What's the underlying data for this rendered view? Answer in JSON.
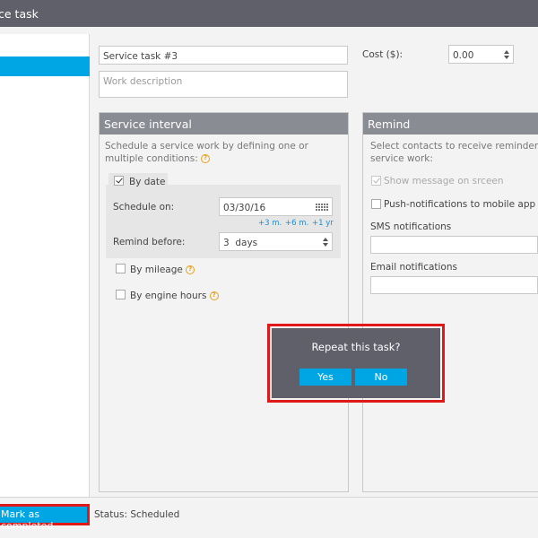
{
  "window": {
    "title": "ce task"
  },
  "task": {
    "name_value": "Service task #3",
    "description_placeholder": "Work description",
    "cost_label": "Cost ($):",
    "cost_value": "0.00"
  },
  "service_interval": {
    "title": "Service interval",
    "description": "Schedule a service work by defining one or multiple conditions:",
    "by_date": {
      "label": "By date",
      "checked": true,
      "schedule_label": "Schedule on:",
      "schedule_value": "03/30/16",
      "shortcuts": [
        "+3 m.",
        "+6 m.",
        "+1 yr"
      ],
      "remind_label": "Remind before:",
      "remind_value": "3  days"
    },
    "by_mileage": {
      "label": "By mileage",
      "checked": false
    },
    "by_engine_hours": {
      "label": "By engine hours",
      "checked": false
    }
  },
  "remind": {
    "title": "Remind",
    "description_line1": "Select contacts to receive reminders tha",
    "description_line2": "service work:",
    "show_message": {
      "label": "Show message on srceen",
      "checked": true,
      "disabled": true
    },
    "push": {
      "label": "Push-notifications to mobile app",
      "checked": false
    },
    "sms_label": "SMS notifications",
    "email_label": "Email notifications"
  },
  "dialog": {
    "question": "Repeat this task?",
    "yes_label": "Yes",
    "no_label": "No"
  },
  "footer": {
    "mark_completed_label": "Mark as completed",
    "status_text": "Status: Scheduled"
  },
  "colors": {
    "accent": "#00a6e3",
    "titlebar": "#5f6069",
    "panel_header": "#8a8c93",
    "highlight": "#e01818",
    "help_icon": "#e9a21b"
  },
  "icons": [
    "help-icon",
    "calendar-icon",
    "spinner-icon",
    "checkmark-icon"
  ]
}
